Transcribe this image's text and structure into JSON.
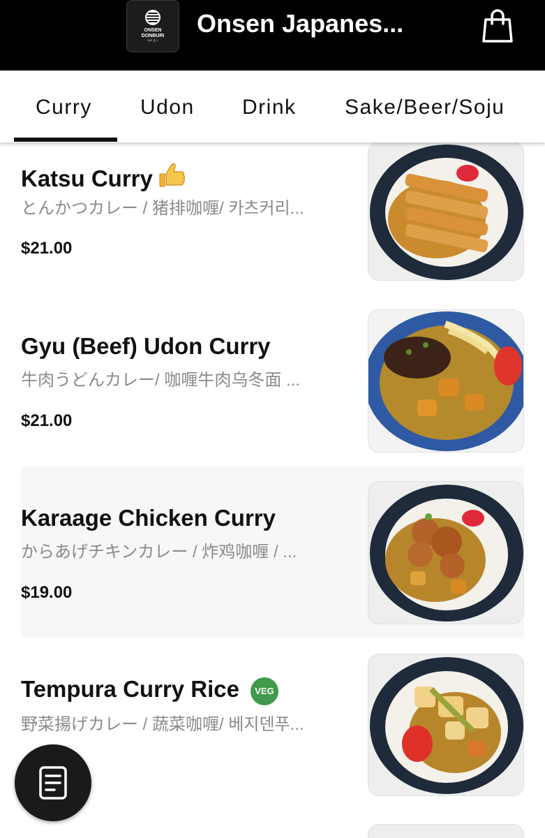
{
  "header": {
    "logo_line1": "ONSEN",
    "logo_line2": "DONBURI",
    "logo_line3": "ᴮᴬᴿ & ᴷ",
    "restaurant_name": "Onsen Japanes...",
    "cart_icon": "shopping-bag-icon"
  },
  "tabs": [
    {
      "label": "Curry",
      "active": true
    },
    {
      "label": "Udon",
      "active": false
    },
    {
      "label": "Drink",
      "active": false
    },
    {
      "label": "Sake/Beer/Soju",
      "active": false
    }
  ],
  "items": [
    {
      "name": "Katsu Curry",
      "badge": "👍",
      "description": "とんかつカレー / 猪排咖喱/ 카츠커리...",
      "price": "$21.00",
      "photo": "katsu-curry-photo"
    },
    {
      "name": "Gyu (Beef) Udon Curry",
      "description": "牛肉うどんカレー/ 咖喱牛肉乌冬面 ...",
      "price": "$21.00",
      "photo": "beef-udon-curry-photo"
    },
    {
      "name": "Karaage Chicken Curry",
      "description": "からあげチキンカレー / 炸鸡咖喱 / ...",
      "price": "$19.00",
      "photo": "karaage-chicken-curry-photo"
    },
    {
      "name": "Tempura Curry Rice",
      "badge": "VEG",
      "description": "野菜揚げカレー / 蔬菜咖喱/ 베지덴푸...",
      "photo": "tempura-curry-rice-photo"
    }
  ],
  "fab": {
    "icon": "order-list-icon"
  },
  "colors": {
    "header_bg": "#000000",
    "veg_badge": "#3f9a4b",
    "shaded_row": "#f7f7f7"
  }
}
